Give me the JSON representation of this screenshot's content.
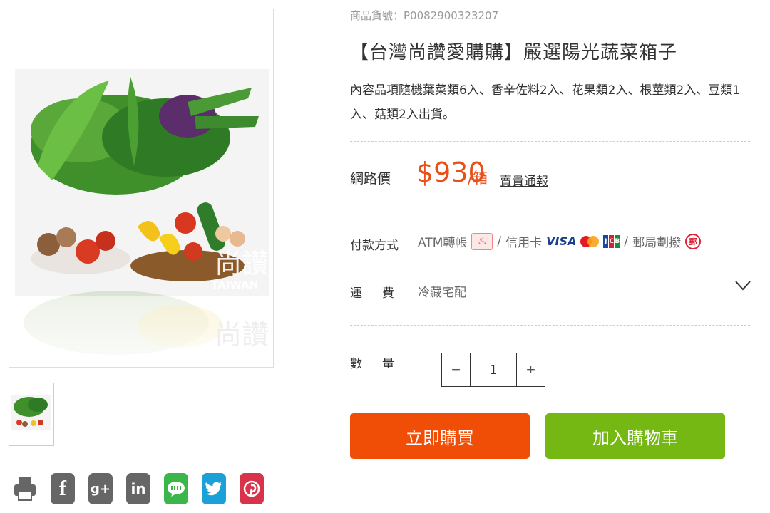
{
  "product": {
    "sku_line": "商品貨號：P0082900323207",
    "title": "【台灣尚讚愛購購】嚴選陽光蔬菜箱子",
    "description": "內容品項隨機葉菜類6入、香辛佐料2入、花果類2入、根莖類2入、豆類1入、菇類2入出貨。",
    "image_brand_text": "尚讚",
    "image_brand_sub": "TAIWAN"
  },
  "price": {
    "label": "網路價",
    "amount": "$930",
    "unit": "/箱",
    "alert_link": "賣貴通報",
    "color": "#e8501a"
  },
  "payment": {
    "label": "付款方式",
    "atm": "ATM轉帳",
    "sep1": "/",
    "credit": "信用卡",
    "visa": "VISA",
    "sep2": "/",
    "post": "郵局劃撥",
    "post_badge": "郵"
  },
  "shipping": {
    "label": "運費",
    "value": "冷藏宅配",
    "icon": "chevron-down-icon"
  },
  "quantity": {
    "label": "數量",
    "minus": "−",
    "value": "1",
    "plus": "+"
  },
  "actions": {
    "buy_now": "立即購買",
    "add_to_cart": "加入購物車",
    "buy_color": "#f04d07",
    "cart_color": "#75b814"
  },
  "share": {
    "icons": [
      "print-icon",
      "facebook-icon",
      "google-plus-icon",
      "linkedin-icon",
      "line-icon",
      "twitter-icon",
      "pinterest-icon"
    ],
    "fb": "f",
    "gp": "g+",
    "li": "in"
  }
}
